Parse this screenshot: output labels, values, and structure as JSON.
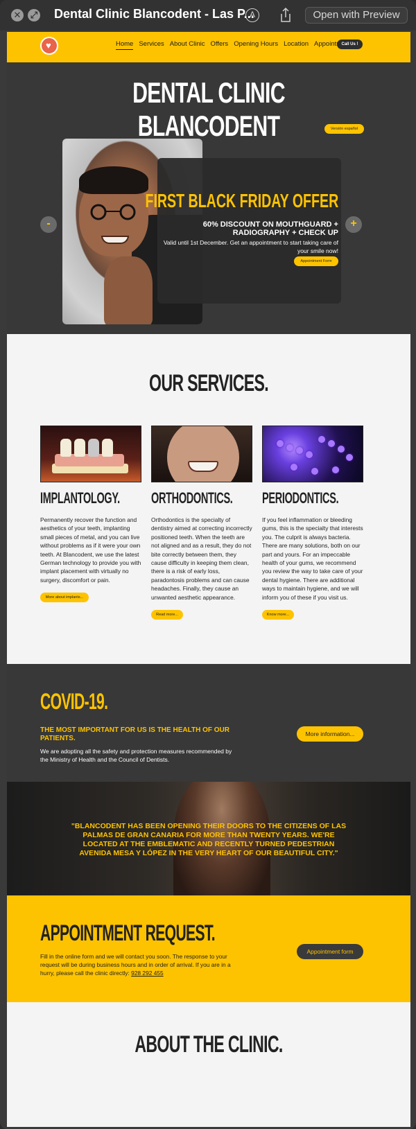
{
  "titlebar": {
    "title": "Dental Clinic Blancodent - Las P...",
    "open_with": "Open with Preview",
    "close_glyph": "✕",
    "fullscreen_glyph": "⤢",
    "markup_glyph": "A"
  },
  "nav": {
    "links": [
      "Home",
      "Services",
      "About Clinic",
      "Offers",
      "Opening Hours",
      "Location",
      "Appointment"
    ],
    "call_button": "Call Us !",
    "accent_color": "#fec300"
  },
  "hero": {
    "title": "DENTAL CLINIC BLANCODENT",
    "lang_button": "Versión español",
    "offer_title": "FIRST BLACK FRIDAY OFFER",
    "offer_subtitle": "60% DISCOUNT ON MOUTHGUARD + RADIOGRAPHY + CHECK UP",
    "offer_text": "Valid until 1st December. Get an appointment to start taking care of your smile now!",
    "offer_button": "Appointment Form",
    "prev_glyph": "-",
    "next_glyph": "+"
  },
  "services": {
    "title": "OUR SERVICES.",
    "items": [
      {
        "name": "IMPLANTOLOGY.",
        "description": "Permanently recover the function and aesthetics of your teeth, implanting small pieces of metal, and you can live without problems as if it were your own teeth. At Blancodent, we use the latest German technology to provide you with implant placement with virtually no surgery, discomfort or pain.",
        "button": "More about implants..."
      },
      {
        "name": "ORTHODONTICS.",
        "description": "Orthodontics is the specialty of dentistry aimed at correcting incorrectly positioned teeth. When the teeth are not aligned and as a result, they do not bite correctly between them, they cause difficulty in keeping them clean, there is a risk of early loss, paradontosis problems and can cause headaches. Finally, they cause an unwanted aesthetic appearance.",
        "button": "Read more..."
      },
      {
        "name": "PERIODONTICS.",
        "description": "If you feel inflammation or bleeding gums, this is the specialty that interests you. The culprit is always bacteria. There are many solutions, both on our part and yours. For an impeccable health of your gums, we recommend you review the way to take care of your dental hygiene. There are additional ways to maintain hygiene, and we will inform you of these if you visit us.",
        "button": "Know more..."
      }
    ]
  },
  "covid": {
    "title": "COVID-19.",
    "subtitle": "THE MOST IMPORTANT FOR US IS THE HEALTH OF OUR PATIENTS.",
    "text": "We are adopting all the safety and protection measures recommended by the Ministry of Health and the Council of Dentists.",
    "button": "More information..."
  },
  "quote": {
    "text": "\"BLANCODENT HAS BEEN OPENING THEIR DOORS TO THE CITIZENS OF LAS PALMAS DE GRAN CANARIA FOR MORE THAN TWENTY YEARS. WE'RE LOCATED AT THE EMBLEMATIC AND RECENTLY TURNED PEDESTRIAN AVENIDA MESA Y LÓPEZ IN THE VERY HEART OF OUR BEAUTIFUL CITY.\""
  },
  "appointment": {
    "title": "APPOINTMENT REQUEST.",
    "text": "Fill in the online form and we will contact you soon. The response to your request will be during business hours and in order of arrival. If you are in a hurry, please call the clinic directly: ",
    "phone": "928 292 455",
    "button": "Appointment form"
  },
  "about": {
    "title": "ABOUT THE CLINIC."
  }
}
